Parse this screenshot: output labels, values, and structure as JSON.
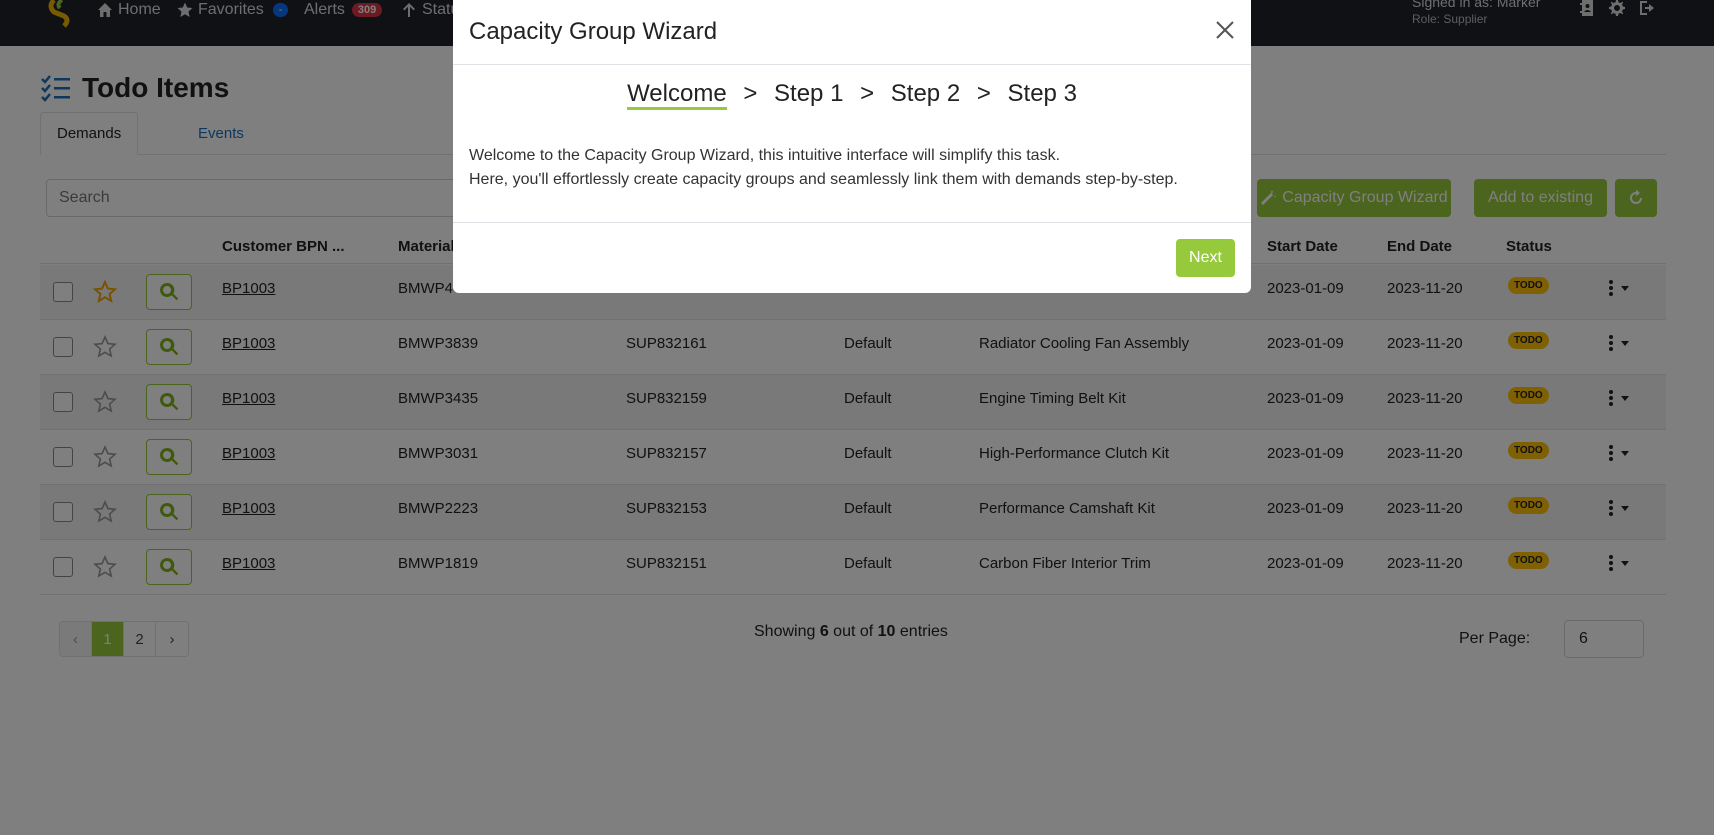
{
  "nav": {
    "home": "Home",
    "favorites": "Favorites",
    "favorites_badge": "-",
    "alerts": "Alerts",
    "alerts_badge": "309",
    "status": "Status",
    "signed_in": "Signed in as: Marker",
    "role": "Role: Supplier"
  },
  "page": {
    "title": "Todo Items",
    "tabs": [
      {
        "label": "Demands"
      },
      {
        "label": "Events"
      }
    ],
    "search_placeholder": "Search"
  },
  "toolbar": {
    "wizard_label": "Capacity Group Wizard",
    "add_existing_label": "Add to existing"
  },
  "table": {
    "headers": {
      "customer_bpn": "Customer BPN ...",
      "material": "Material",
      "start_date": "Start Date",
      "end_date": "End Date",
      "status": "Status"
    },
    "rows": [
      {
        "bpn": "BP1003",
        "material": "BMWP4",
        "supplier": "",
        "unit": "",
        "description": "",
        "start": "2023-01-09",
        "end": "2023-11-20",
        "status": "TODO",
        "favorite": true
      },
      {
        "bpn": "BP1003",
        "material": "BMWP3839",
        "supplier": "SUP832161",
        "unit": "Default",
        "description": "Radiator Cooling Fan Assembly",
        "start": "2023-01-09",
        "end": "2023-11-20",
        "status": "TODO",
        "favorite": false
      },
      {
        "bpn": "BP1003",
        "material": "BMWP3435",
        "supplier": "SUP832159",
        "unit": "Default",
        "description": "Engine Timing Belt Kit",
        "start": "2023-01-09",
        "end": "2023-11-20",
        "status": "TODO",
        "favorite": false
      },
      {
        "bpn": "BP1003",
        "material": "BMWP3031",
        "supplier": "SUP832157",
        "unit": "Default",
        "description": "High-Performance Clutch Kit",
        "start": "2023-01-09",
        "end": "2023-11-20",
        "status": "TODO",
        "favorite": false
      },
      {
        "bpn": "BP1003",
        "material": "BMWP2223",
        "supplier": "SUP832153",
        "unit": "Default",
        "description": "Performance Camshaft Kit",
        "start": "2023-01-09",
        "end": "2023-11-20",
        "status": "TODO",
        "favorite": false
      },
      {
        "bpn": "BP1003",
        "material": "BMWP1819",
        "supplier": "SUP832151",
        "unit": "Default",
        "description": "Carbon Fiber Interior Trim",
        "start": "2023-01-09",
        "end": "2023-11-20",
        "status": "TODO",
        "favorite": false
      }
    ]
  },
  "pagination": {
    "prev": "‹",
    "pages": [
      "1",
      "2"
    ],
    "next": "›",
    "showing_prefix": "Showing ",
    "shown": "6",
    "mid": " out of ",
    "total": "10",
    "suffix": " entries",
    "per_page_label": "Per Page:",
    "per_page_value": "6"
  },
  "modal": {
    "title": "Capacity Group Wizard",
    "steps": [
      "Welcome",
      "Step 1",
      "Step 2",
      "Step 3"
    ],
    "separator": ">",
    "line1": "Welcome to the Capacity Group Wizard, this intuitive interface will simplify this task.",
    "line2": "Here, you'll effortlessly create capacity groups and seamlessly link them with demands step-by-step.",
    "next_label": "Next"
  },
  "colors": {
    "accent": "#97c93c",
    "navbar": "#1e2228",
    "status_badge": "#ffc107",
    "star_active": "#f0a500"
  }
}
